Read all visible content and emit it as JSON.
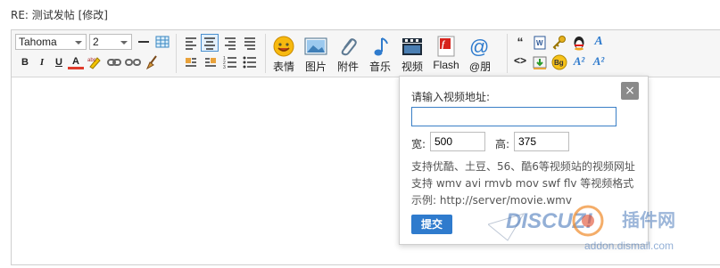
{
  "page": {
    "title": "RE: 测试发帖 [修改]"
  },
  "toolbar": {
    "font_family": "Tahoma",
    "font_size": "2",
    "buttons": {
      "bold": "B",
      "italic": "I",
      "underline": "U",
      "color": "A"
    },
    "big_buttons": [
      {
        "label": "表情",
        "icon": "smiley-icon"
      },
      {
        "label": "图片",
        "icon": "image-icon"
      },
      {
        "label": "附件",
        "icon": "paperclip-icon"
      },
      {
        "label": "音乐",
        "icon": "music-note-icon"
      },
      {
        "label": "视频",
        "icon": "clapperboard-icon"
      },
      {
        "label": "Flash",
        "icon": "flash-icon"
      },
      {
        "label": "@朋",
        "icon": "at-icon"
      }
    ]
  },
  "video_popup": {
    "label": "请输入视频地址:",
    "url_value": "",
    "width_label": "宽:",
    "width_value": "500",
    "height_label": "高:",
    "height_value": "375",
    "info_line1": "支持优酷、土豆、56、酷6等视频站的视频网址",
    "info_line2": "支持 wmv avi rmvb mov swf flv 等视频格式",
    "info_line3": "示例: http://server/movie.wmv",
    "submit_label": "提交",
    "close_label": "×"
  },
  "watermark": {
    "text": "DISCUZ!",
    "cn_text": "插件网",
    "url": "addon.dismall.com"
  },
  "colors": {
    "accent": "#2f7bcd",
    "watermark_blue": "#3b6fb5"
  }
}
